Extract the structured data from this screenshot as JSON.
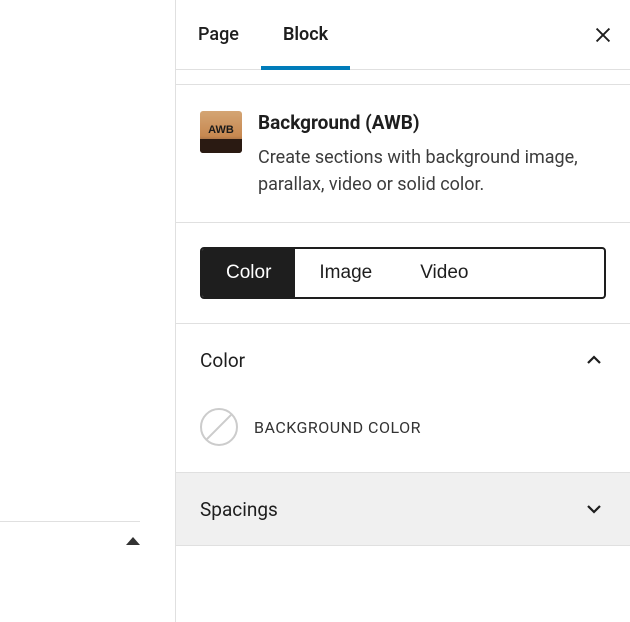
{
  "tabs": {
    "page": "Page",
    "block": "Block"
  },
  "block_header": {
    "title": "Background (AWB)",
    "description": "Create sections with background image, parallax, video or solid color.",
    "icon_label": "AWB"
  },
  "type_options": {
    "color": "Color",
    "image": "Image",
    "video": "Video"
  },
  "sections": {
    "color": {
      "title": "Color",
      "bg_color_label": "BACKGROUND COLOR"
    },
    "spacings": {
      "title": "Spacings"
    }
  }
}
